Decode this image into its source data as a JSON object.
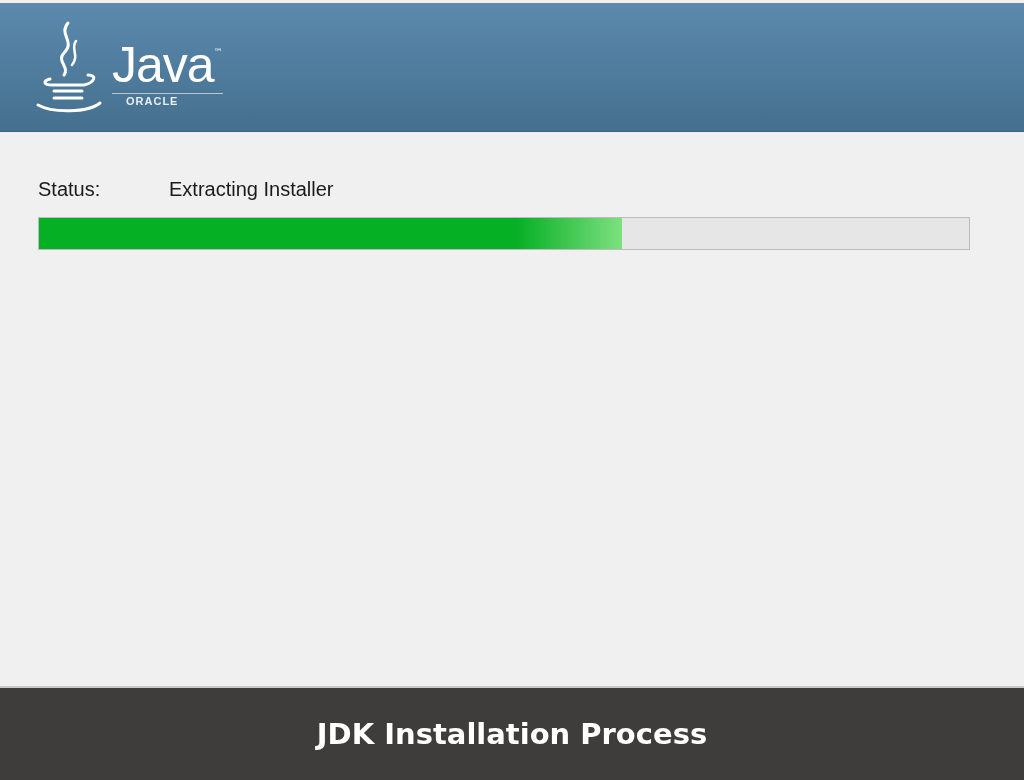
{
  "header": {
    "logo_text": "Java",
    "trademark": "™",
    "brand": "ORACLE"
  },
  "status": {
    "label": "Status:",
    "value": "Extracting Installer"
  },
  "progress": {
    "level": 0.627
  },
  "caption": "JDK Installation Process"
}
